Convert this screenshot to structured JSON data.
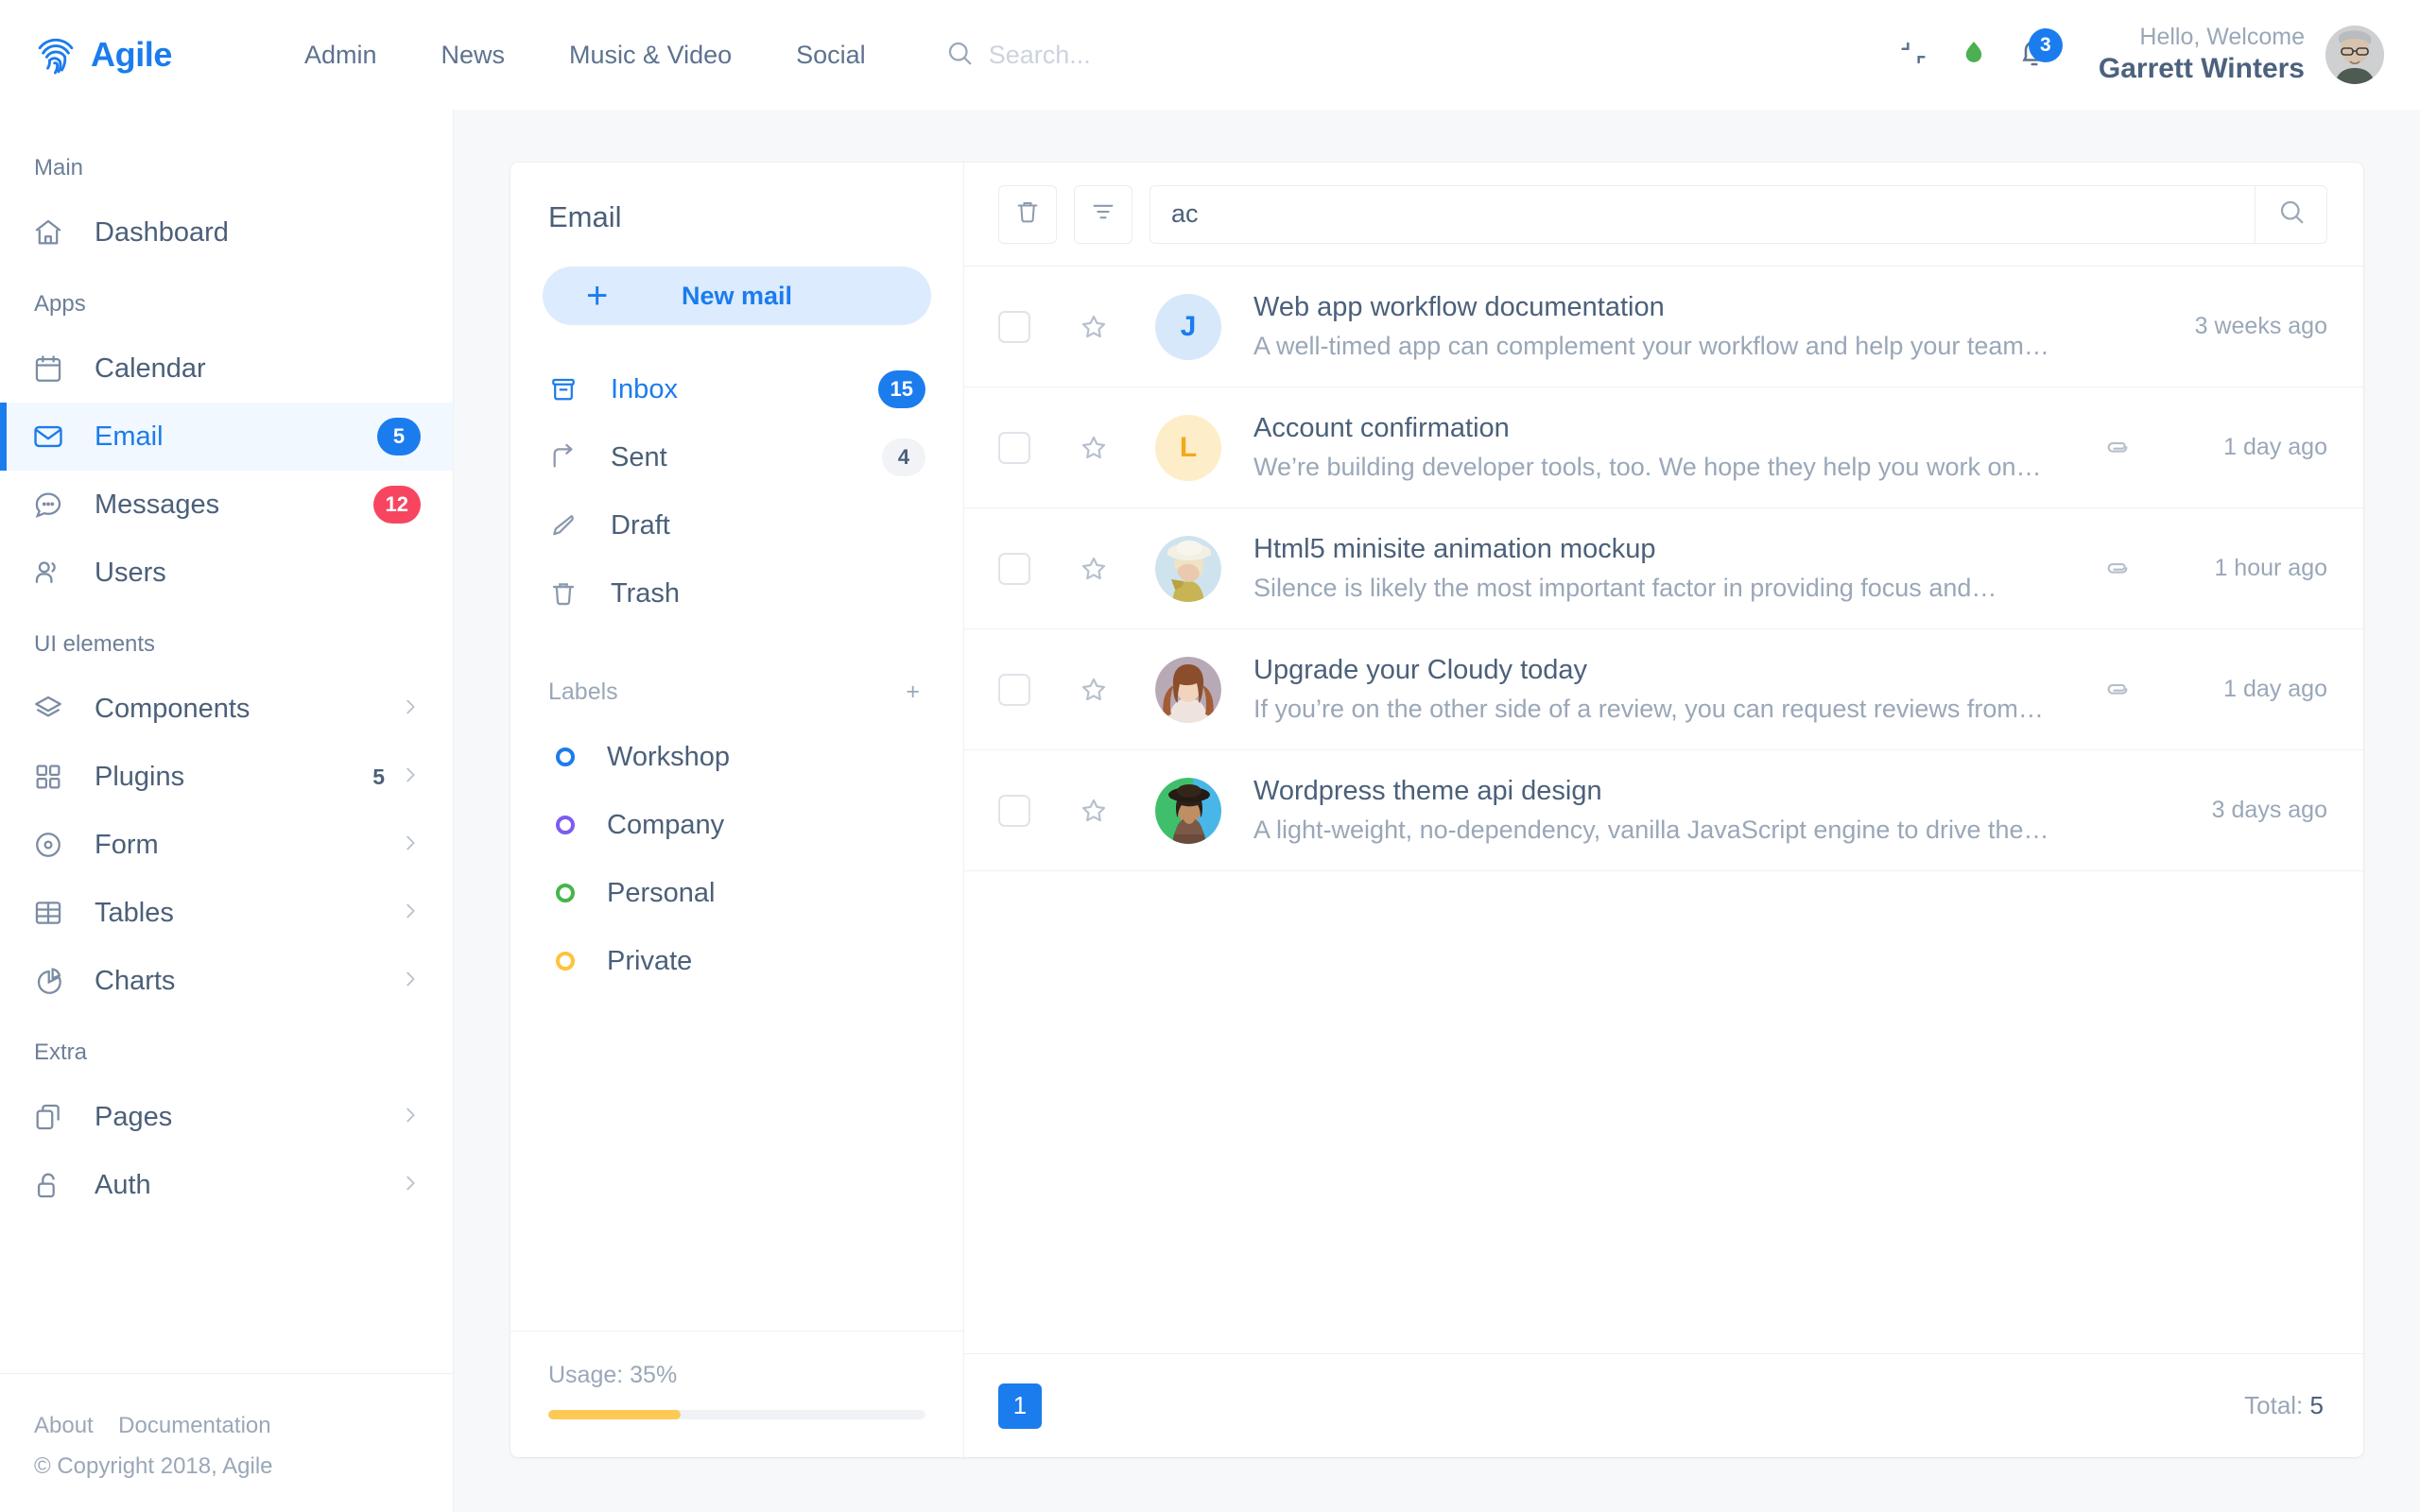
{
  "header": {
    "brand": "Agile",
    "brand_logo_icon": "fingerprint-icon",
    "nav": [
      {
        "label": "Admin"
      },
      {
        "label": "News"
      },
      {
        "label": "Music & Video"
      },
      {
        "label": "Social"
      }
    ],
    "search": {
      "placeholder": "Search...",
      "value": "",
      "icon": "search-icon"
    },
    "compress_icon": "compress-icon",
    "droplet_icon": "droplet-icon",
    "droplet_color": "#4caf50",
    "bell_icon": "bell-icon",
    "bell_badge": "3",
    "greeting_hello": "Hello, Welcome",
    "greeting_name": "Garrett Winters",
    "accent": "#1b7ced"
  },
  "sidebar": {
    "sections": [
      {
        "title": "Main",
        "items": [
          {
            "label": "Dashboard",
            "icon": "home-icon",
            "badge": "",
            "badge_color": "",
            "chevron": false,
            "count": "",
            "active": false
          }
        ]
      },
      {
        "title": "Apps",
        "items": [
          {
            "label": "Calendar",
            "icon": "calendar-icon",
            "badge": "",
            "badge_color": "",
            "chevron": false,
            "count": "",
            "active": false
          },
          {
            "label": "Email",
            "icon": "mail-icon",
            "badge": "5",
            "badge_color": "blue",
            "chevron": false,
            "count": "",
            "active": true
          },
          {
            "label": "Messages",
            "icon": "chat-icon",
            "badge": "12",
            "badge_color": "red",
            "chevron": false,
            "count": "",
            "active": false
          },
          {
            "label": "Users",
            "icon": "users-icon",
            "badge": "",
            "badge_color": "",
            "chevron": false,
            "count": "",
            "active": false
          }
        ]
      },
      {
        "title": "UI elements",
        "items": [
          {
            "label": "Components",
            "icon": "layers-icon",
            "badge": "",
            "badge_color": "",
            "chevron": true,
            "count": "",
            "active": false
          },
          {
            "label": "Plugins",
            "icon": "grid-icon",
            "badge": "",
            "badge_color": "",
            "chevron": true,
            "count": "5",
            "active": false
          },
          {
            "label": "Form",
            "icon": "radio-icon",
            "badge": "",
            "badge_color": "",
            "chevron": true,
            "count": "",
            "active": false
          },
          {
            "label": "Tables",
            "icon": "table-icon",
            "badge": "",
            "badge_color": "",
            "chevron": true,
            "count": "",
            "active": false
          },
          {
            "label": "Charts",
            "icon": "pie-chart-icon",
            "badge": "",
            "badge_color": "",
            "chevron": true,
            "count": "",
            "active": false
          }
        ]
      },
      {
        "title": "Extra",
        "items": [
          {
            "label": "Pages",
            "icon": "copy-icon",
            "badge": "",
            "badge_color": "",
            "chevron": true,
            "count": "",
            "active": false
          },
          {
            "label": "Auth",
            "icon": "unlock-icon",
            "badge": "",
            "badge_color": "",
            "chevron": true,
            "count": "",
            "active": false
          }
        ]
      }
    ],
    "footer": {
      "about": "About",
      "documentation": "Documentation",
      "copyright": "© Copyright 2018, Agile"
    }
  },
  "mail_nav": {
    "title": "Email",
    "new_mail_label": "New mail",
    "new_mail_icon": "plus-icon",
    "folders": [
      {
        "label": "Inbox",
        "icon": "inbox-icon",
        "count": "15",
        "count_style": "blue",
        "active": true
      },
      {
        "label": "Sent",
        "icon": "sent-icon",
        "count": "4",
        "count_style": "grey",
        "active": false
      },
      {
        "label": "Draft",
        "icon": "pencil-icon",
        "count": "",
        "count_style": "",
        "active": false
      },
      {
        "label": "Trash",
        "icon": "trash-icon",
        "count": "",
        "count_style": "",
        "active": false
      }
    ],
    "labels_header": "Labels",
    "labels_add_icon": "plus-icon",
    "labels": [
      {
        "label": "Workshop",
        "color": "#1b7ced"
      },
      {
        "label": "Company",
        "color": "#7c5cf0"
      },
      {
        "label": "Personal",
        "color": "#45b649"
      },
      {
        "label": "Private",
        "color": "#fcc43c"
      }
    ],
    "usage_text": "Usage: 35%",
    "usage_percent": 35,
    "usage_color": "#fcc954"
  },
  "mail_toolbar": {
    "delete_icon": "trash-icon",
    "filter_icon": "filter-icon",
    "search_value": "ac",
    "search_placeholder": "",
    "search_submit_icon": "search-icon"
  },
  "mail_rows": [
    {
      "subject": "Web app workflow documentation",
      "snippet": "A well-timed app can complement your workflow and help your team…",
      "time": "3 weeks ago",
      "avatar_type": "letter",
      "avatar_letter": "J",
      "avatar_bg": "#d7e8fb",
      "avatar_fg": "#1b7ced",
      "attachment": false,
      "starred": false,
      "checked": false
    },
    {
      "subject": "Account confirmation",
      "snippet": "We’re building developer tools, too. We hope they help you work on…",
      "time": "1 day ago",
      "avatar_type": "letter",
      "avatar_letter": "L",
      "avatar_bg": "#fdeec9",
      "avatar_fg": "#f2a91c",
      "attachment": true,
      "starred": false,
      "checked": false
    },
    {
      "subject": "Html5 minisite animation mockup",
      "snippet": "Silence is likely the most important factor in providing focus and…",
      "time": "1 hour ago",
      "avatar_type": "photo",
      "avatar_letter": "",
      "avatar_bg": "#cfe0ea",
      "avatar_fg": "",
      "attachment": true,
      "starred": false,
      "checked": false
    },
    {
      "subject": "Upgrade your Cloudy today",
      "snippet": "If you’re on the other side of a review, you can request reviews from…",
      "time": "1 day ago",
      "avatar_type": "photo",
      "avatar_letter": "",
      "avatar_bg": "#b9a7b0",
      "avatar_fg": "",
      "attachment": true,
      "starred": false,
      "checked": false
    },
    {
      "subject": "Wordpress theme api design",
      "snippet": "A light-weight, no-dependency, vanilla JavaScript engine to drive the…",
      "time": "3 days ago",
      "avatar_type": "photo",
      "avatar_letter": "",
      "avatar_bg": "#36c26a",
      "avatar_fg": "",
      "attachment": false,
      "starred": false,
      "checked": false
    }
  ],
  "mail_footer": {
    "page_current": "1",
    "total_label": "Total:",
    "total_value": "5"
  }
}
